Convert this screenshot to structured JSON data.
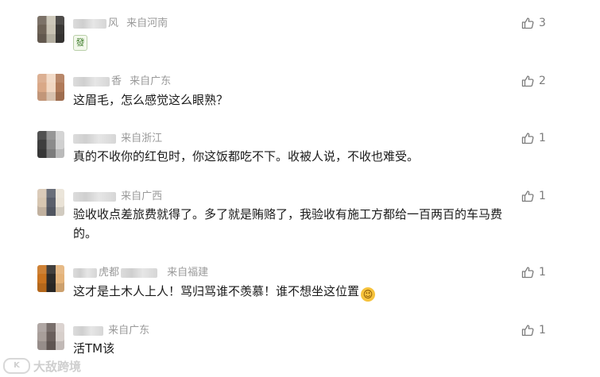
{
  "comments": [
    {
      "name_visible": "风",
      "region": "来自河南",
      "text": "",
      "sticker": "發",
      "likes": "3",
      "avatar_colors": [
        "#6e6357",
        "#c8c2b3",
        "#3a3836"
      ]
    },
    {
      "name_visible": "香",
      "region": "来自广东",
      "text": "这眉毛，怎么感觉这么眼熟？",
      "likes": "2",
      "avatar_colors": [
        "#d9a887",
        "#f1d7c2",
        "#b07a59"
      ]
    },
    {
      "name_visible": "",
      "region": "来自浙江",
      "text": "真的不收你的红包时，你这饭都吃不下。收被人说，不收也难受。",
      "likes": "1",
      "avatar_colors": [
        "#3e3e3e",
        "#8b8b8b",
        "#d0d0d0"
      ]
    },
    {
      "name_visible": "",
      "region": "来自广西",
      "text": "验收收点差旅费就得了。多了就是贿赂了，我验收有施工方都给一百两百的车马费的。",
      "likes": "1",
      "avatar_colors": [
        "#d7c6b1",
        "#5a5f6b",
        "#e9e2d6"
      ]
    },
    {
      "name_visible": "虎都",
      "region": "来自福建",
      "text": "这才是土木人上人！骂归骂谁不羡慕！谁不想坐这位置",
      "emoji": "😉",
      "likes": "1",
      "avatar_colors": [
        "#c9731f",
        "#2d2b29",
        "#e4b37a"
      ]
    },
    {
      "name_visible": "",
      "region": "来自广东",
      "text": "活TM该",
      "likes": "1",
      "avatar_colors": [
        "#a89e9a",
        "#6a5f5c",
        "#d7cfcb"
      ]
    }
  ],
  "watermark": {
    "logo_text": "K",
    "text": "大敌跨境"
  },
  "icons": {
    "like": "thumbs-up-icon",
    "emoji": "wink-emoji-icon",
    "sticker": "mahjong-fa-sticker-icon"
  }
}
